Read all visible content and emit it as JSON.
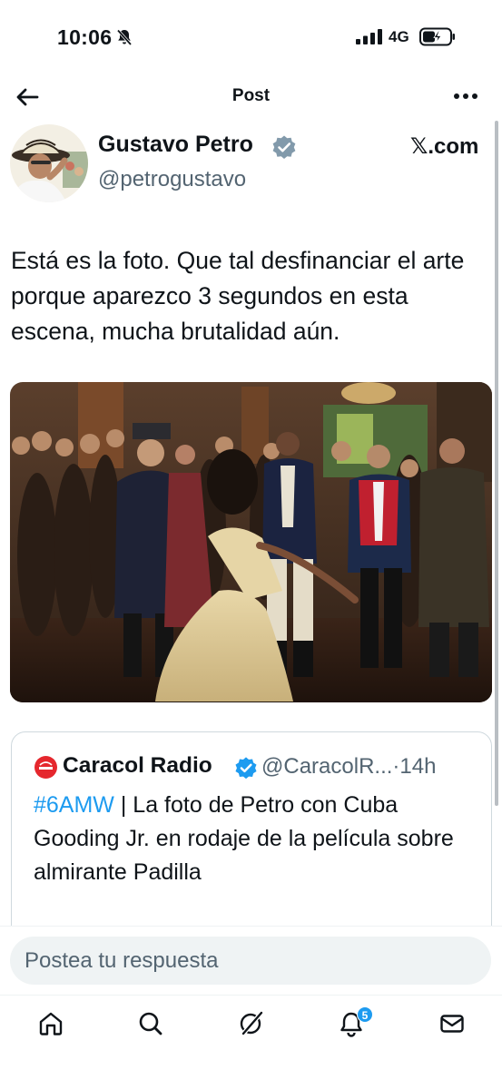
{
  "status_bar": {
    "time": "10:06",
    "network": "4G"
  },
  "header": {
    "title": "Post"
  },
  "author": {
    "name": "Gustavo Petro",
    "handle": "@petrogustavo",
    "source": "𝕏.com"
  },
  "tweet": {
    "text": "Está es la foto. Que tal desfinanciar el arte porque aparezco 3 segundos en esta escena, mucha brutalidad aún."
  },
  "quote": {
    "name": "Caracol Radio",
    "handle": "@CaracolR...",
    "time": "·14h",
    "hashtag": "#6AMW",
    "text": " | La foto de Petro con Cuba Gooding Jr. en rodaje de la película sobre almirante Padilla"
  },
  "reply": {
    "placeholder": "Postea tu respuesta"
  },
  "bottom_nav": {
    "notifications_count": "5",
    "icons": [
      "home-icon",
      "search-icon",
      "grok-icon",
      "notifications-icon",
      "messages-icon"
    ]
  },
  "colors": {
    "accent": "#1d9bf0",
    "secondary_text": "#536471",
    "primary_text": "#0f1419",
    "verified_logo_red": "#e5272d"
  }
}
